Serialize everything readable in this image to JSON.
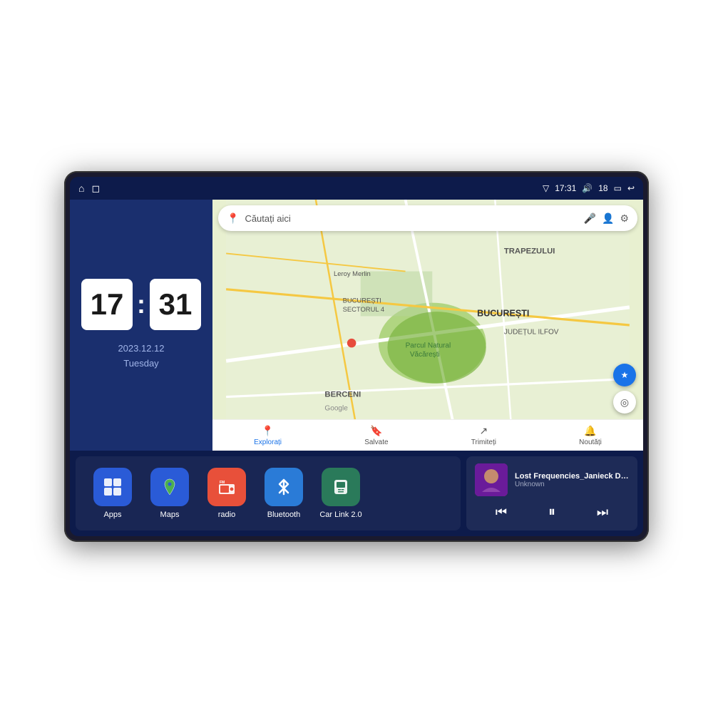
{
  "device": {
    "screen_bg": "#0d1b4b"
  },
  "status_bar": {
    "time": "17:31",
    "signal_icon": "▽",
    "volume_icon": "🔊",
    "battery_level": "18",
    "battery_icon": "▭",
    "back_icon": "↩",
    "home_icon": "⌂",
    "nav_icon": "◻"
  },
  "clock_widget": {
    "hours": "17",
    "minutes": "31",
    "date": "2023.12.12",
    "day": "Tuesday"
  },
  "map": {
    "search_placeholder": "Căutați aici",
    "location_names": [
      "TRAPEZULUI",
      "BUCUREȘTI",
      "JUDEȚUL ILFOV",
      "BERCENI",
      "Parcul Natural Văcărești",
      "Leroy Merlin",
      "BUCUREȘTI SECTORUL 4"
    ],
    "tabs": [
      {
        "label": "Explorați",
        "icon": "📍",
        "active": true
      },
      {
        "label": "Salvate",
        "icon": "🔖",
        "active": false
      },
      {
        "label": "Trimiteți",
        "icon": "↗",
        "active": false
      },
      {
        "label": "Noutăți",
        "icon": "🔔",
        "active": false
      }
    ]
  },
  "apps": [
    {
      "id": "apps",
      "label": "Apps",
      "icon": "⊞",
      "color": "#2a5bd7"
    },
    {
      "id": "maps",
      "label": "Maps",
      "icon": "📍",
      "color": "#2a5bd7"
    },
    {
      "id": "radio",
      "label": "radio",
      "icon": "📻",
      "color": "#e8503a"
    },
    {
      "id": "bluetooth",
      "label": "Bluetooth",
      "icon": "✦",
      "color": "#2a7bd7"
    },
    {
      "id": "carlink",
      "label": "Car Link 2.0",
      "icon": "📱",
      "color": "#2a7a5a"
    }
  ],
  "music": {
    "title": "Lost Frequencies_Janieck Devy-...",
    "artist": "Unknown",
    "prev_icon": "⏮",
    "play_icon": "⏸",
    "next_icon": "⏭"
  }
}
